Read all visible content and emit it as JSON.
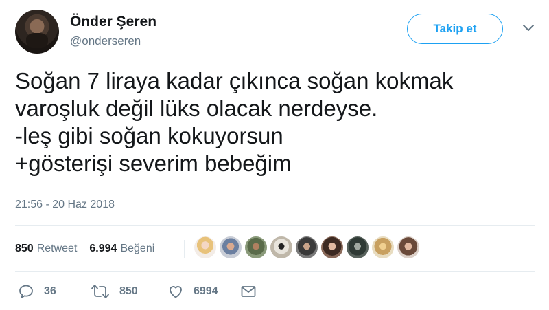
{
  "user": {
    "name": "Önder Şeren",
    "handle": "@onderseren",
    "follow_label": "Takip et"
  },
  "tweet": {
    "text": "Soğan 7 liraya kadar çıkınca soğan kokmak\nvaroşluk değil lüks olacak nerdeyse.\n-leş gibi soğan kokuyorsun\n+gösterişi severim bebeğim",
    "timestamp": "21:56 - 20 Haz 2018"
  },
  "stats": {
    "retweets": "850",
    "retweet_label": "Retweet",
    "likes": "6.994",
    "likes_label": "Beğeni"
  },
  "likers_count": 9,
  "actions": {
    "reply_count": "36",
    "retweet_count": "850",
    "like_count": "6994"
  },
  "colors": {
    "accent": "#1da1f2",
    "muted": "#657786",
    "text": "#14171a",
    "divider": "#e6ecf0"
  },
  "icons": [
    "chevron-down-icon",
    "reply-icon",
    "retweet-icon",
    "heart-icon",
    "message-icon"
  ]
}
